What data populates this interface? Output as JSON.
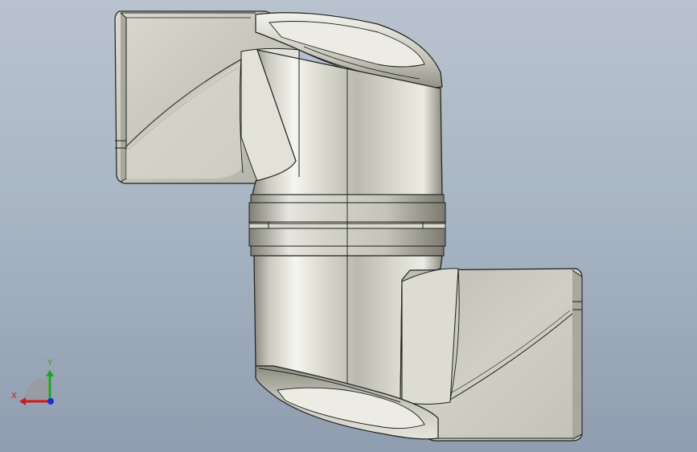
{
  "viewport": {
    "model": "swept-elbow-part",
    "background_top": "#b9c3cf",
    "background_bottom": "#8f9db0"
  },
  "model_colors": {
    "metal_light": "#f1f1ea",
    "metal_mid": "#c8c8bc",
    "metal_dark": "#7d7d72",
    "edge": "#1f1f1f"
  },
  "triad": {
    "x_label": "X",
    "y_label": "Y",
    "x_color": "#d11a1a",
    "y_color": "#1aa81a",
    "z_color": "#1a2fd1"
  }
}
